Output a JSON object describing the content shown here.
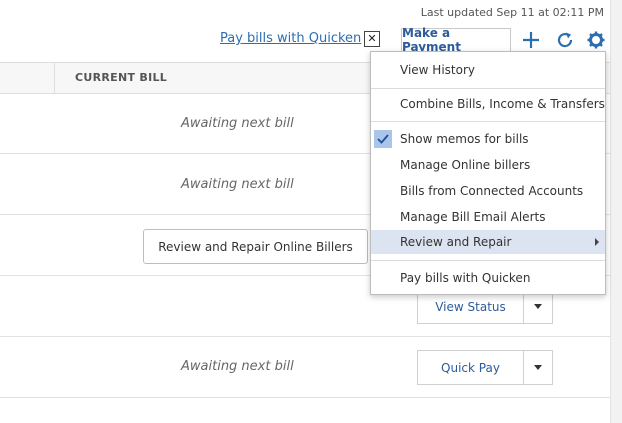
{
  "header": {
    "last_updated": "Last updated Sep 11 at 02:11 PM",
    "quicken_link": "Pay bills with Quicken",
    "close_label": "✕",
    "make_payment_label": "Make a Payment",
    "icons": [
      "plus-icon",
      "refresh-icon",
      "gear-icon"
    ],
    "accent_color": "#2d6eb0"
  },
  "table": {
    "column_current_bill": "CURRENT BILL",
    "rows": [
      {
        "status": "Awaiting next bill"
      },
      {
        "status": "Awaiting next bill"
      },
      {
        "button": "Review and Repair Online Billers"
      },
      {
        "action": "View Status"
      },
      {
        "status": "Awaiting next bill",
        "action": "Quick Pay"
      }
    ]
  },
  "menu": {
    "items": [
      {
        "label": "View History"
      },
      {
        "label": "Combine Bills, Income & Transfers"
      },
      {
        "label": "Show memos for bills",
        "checked": true
      },
      {
        "label": "Manage Online billers"
      },
      {
        "label": "Bills from Connected Accounts"
      },
      {
        "label": "Manage Bill Email Alerts"
      },
      {
        "label": "Review and Repair",
        "highlighted": true,
        "submenu": true
      },
      {
        "label": "Pay bills with Quicken"
      }
    ]
  }
}
